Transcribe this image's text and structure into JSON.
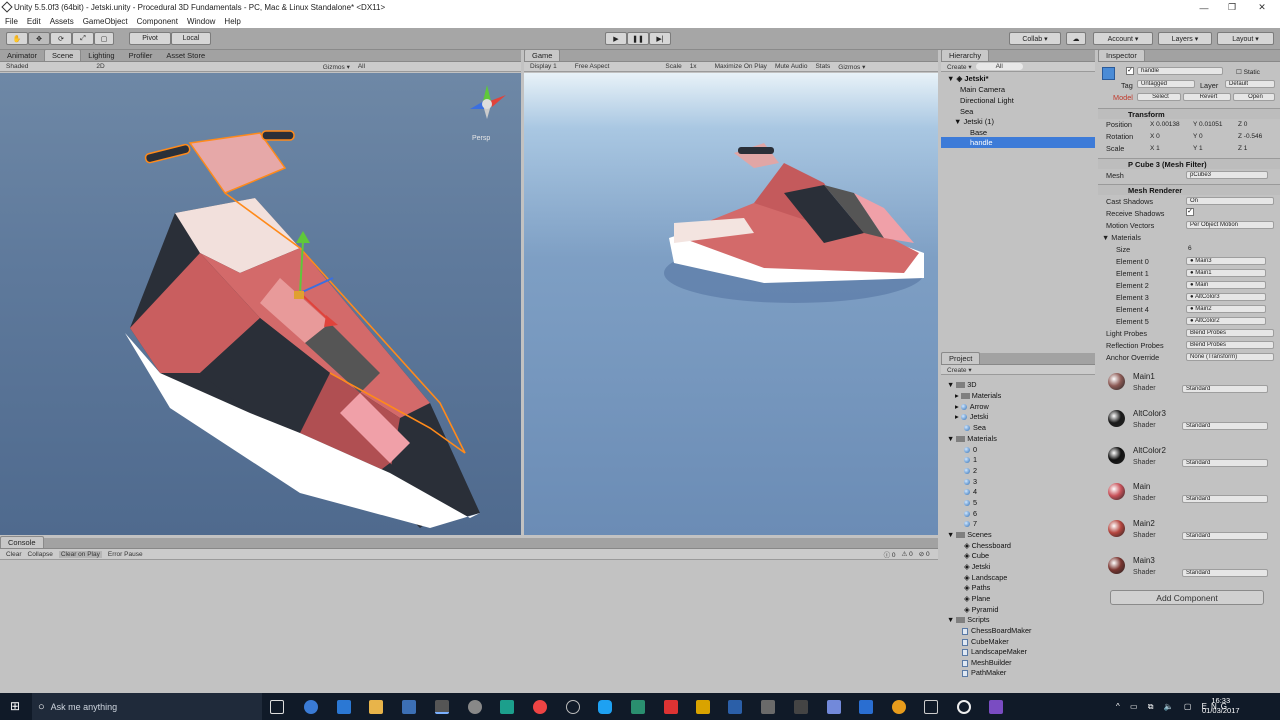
{
  "window": {
    "title": "Unity 5.5.0f3 (64bit) - Jetski.unity - Procedural 3D Fundamentals - PC, Mac & Linux Standalone* <DX11>"
  },
  "menu": [
    "File",
    "Edit",
    "Assets",
    "GameObject",
    "Component",
    "Window",
    "Help"
  ],
  "toolbar": {
    "pivot": "Pivot",
    "local": "Local",
    "collab": "Collab ▾",
    "account": "Account ▾",
    "layers": "Layers ▾",
    "layout": "Layout ▾"
  },
  "scene_tabs": {
    "animator": "Animator",
    "scene": "Scene",
    "lighting": "Lighting",
    "profiler": "Profiler",
    "asset_store": "Asset Store"
  },
  "scene_bar": {
    "shaded": "Shaded",
    "mode2d": "2D",
    "gizmos": "Gizmos ▾",
    "search": "All",
    "persp": "Persp"
  },
  "game_tab": {
    "label": "Game",
    "display": "Display 1",
    "aspect": "Free Aspect",
    "scale": "Scale",
    "scale_val": "1x",
    "maximize": "Maximize On Play",
    "mute": "Mute Audio",
    "stats": "Stats",
    "gizmos": "Gizmos ▾"
  },
  "hierarchy": {
    "tab": "Hierarchy",
    "create": "Create ▾",
    "search": "All",
    "scene": "Jetski*",
    "items": [
      "Main Camera",
      "Directional Light",
      "Sea",
      "Jetski (1)",
      "Base",
      "handle"
    ]
  },
  "project": {
    "tab": "Project",
    "create": "Create ▾",
    "folders": [
      "3D",
      "Materials",
      "Arrow",
      "Jetski",
      "Sea",
      "Materials",
      "0",
      "1",
      "2",
      "3",
      "4",
      "5",
      "6",
      "7",
      "Scenes",
      "Chessboard",
      "Cube",
      "Jetski",
      "Landscape",
      "Paths",
      "Plane",
      "Pyramid",
      "Scripts",
      "ChessBoardMaker",
      "CubeMaker",
      "LandscapeMaker",
      "MeshBuilder",
      "PathMaker"
    ]
  },
  "inspector": {
    "tab": "Inspector",
    "name": "handle",
    "static": "Static",
    "tag_label": "Tag",
    "tag": "Untagged",
    "layer_label": "Layer",
    "layer": "Default",
    "model": "Model",
    "select": "Select",
    "revert": "Revert",
    "open": "Open",
    "transform": {
      "title": "Transform",
      "position": "Position",
      "pos_x": "0.00138",
      "pos_y": "0.01051",
      "pos_z": "0",
      "rotation": "Rotation",
      "rot_x": "0",
      "rot_y": "0",
      "rot_z": "-0.546",
      "scale": "Scale",
      "sc_x": "1",
      "sc_y": "1",
      "sc_z": "1"
    },
    "mesh_filter": {
      "title": "P Cube 3 (Mesh Filter)",
      "mesh_label": "Mesh",
      "mesh": "pCube3"
    },
    "mesh_renderer": {
      "title": "Mesh Renderer",
      "cast_shadows": "Cast Shadows",
      "cast_val": "On",
      "receive_shadows": "Receive Shadows",
      "motion_vectors": "Motion Vectors",
      "motion_val": "Per Object Motion",
      "materials": "Materials",
      "size_label": "Size",
      "size": "6",
      "elements": [
        {
          "label": "Element 0",
          "value": "Main3"
        },
        {
          "label": "Element 1",
          "value": "Main1"
        },
        {
          "label": "Element 2",
          "value": "Main"
        },
        {
          "label": "Element 3",
          "value": "AltColor3"
        },
        {
          "label": "Element 4",
          "value": "Main2"
        },
        {
          "label": "Element 5",
          "value": "AltColor2"
        }
      ],
      "light_probes": "Light Probes",
      "light_val": "Blend Probes",
      "reflection_probes": "Reflection Probes",
      "reflection_val": "Blend Probes",
      "anchor": "Anchor Override",
      "anchor_val": "None (Transform)"
    },
    "materials_list": [
      {
        "name": "Main1",
        "shader_label": "Shader",
        "shader": "Standard",
        "color": "#8c5a55"
      },
      {
        "name": "AltColor3",
        "shader_label": "Shader",
        "shader": "Standard",
        "color": "#1a1a1a"
      },
      {
        "name": "AltColor2",
        "shader_label": "Shader",
        "shader": "Standard",
        "color": "#101010"
      },
      {
        "name": "Main",
        "shader_label": "Shader",
        "shader": "Standard",
        "color": "#c8525a"
      },
      {
        "name": "Main2",
        "shader_label": "Shader",
        "shader": "Standard",
        "color": "#b5463f"
      },
      {
        "name": "Main3",
        "shader_label": "Shader",
        "shader": "Standard",
        "color": "#7a3530"
      }
    ],
    "add_component": "Add Component"
  },
  "console": {
    "tab": "Console",
    "clear": "Clear",
    "collapse": "Collapse",
    "clear_on_play": "Clear on Play",
    "error_pause": "Error Pause",
    "c0": "0",
    "c1": "0",
    "c2": "0"
  },
  "taskbar": {
    "search": "Ask me anything",
    "time": "16:33",
    "date": "01/03/2017"
  },
  "colors": {
    "selection": "#3d7bd8",
    "hull": "#d36a6a",
    "dark": "#2a2f38",
    "outline": "#ff8a1a"
  }
}
